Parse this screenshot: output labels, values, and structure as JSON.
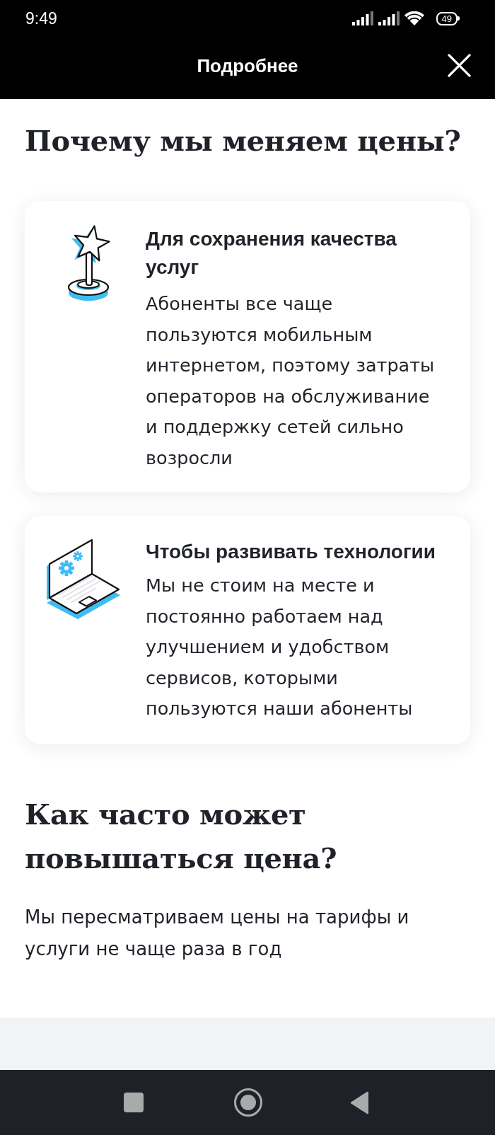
{
  "status_bar": {
    "time": "9:49",
    "battery": "49"
  },
  "header": {
    "title": "Подробнее"
  },
  "reasons": {
    "heading": "Почему мы меняем цены?",
    "cards": [
      {
        "kind": "trophy",
        "title": "Для сохранения качества услуг",
        "text": "Абоненты все чаще пользуются мобильным интернетом, поэтому затраты операторов на обслуживание и поддержку сетей сильно возросли"
      },
      {
        "kind": "laptop",
        "title": "Чтобы развивать технологии",
        "text": "Мы не стоим на месте и постоянно работаем над улучшением и удобством сервисов, которыми пользуются наши абоненты"
      }
    ]
  },
  "frequency": {
    "heading": "Как часто может повышаться цена?",
    "text": "Мы пересматриваем цены на тарифы и услуги не чаще раза в год"
  }
}
